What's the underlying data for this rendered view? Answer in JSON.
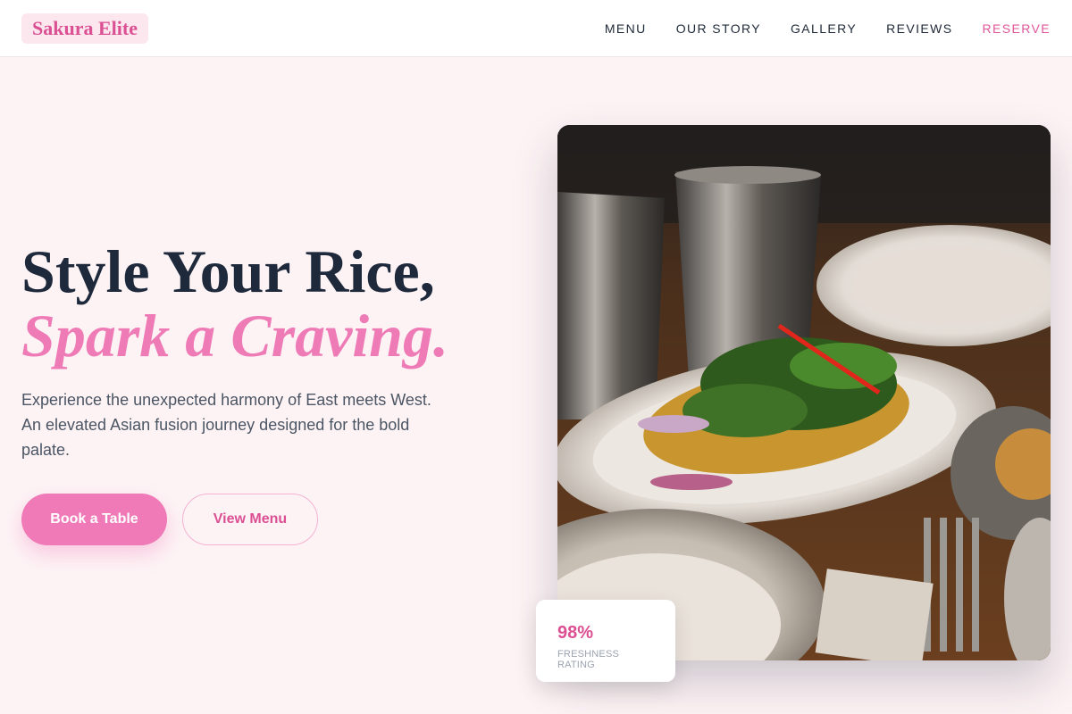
{
  "brand": {
    "name": "Sakura Elite"
  },
  "nav": {
    "items": [
      {
        "label": "MENU"
      },
      {
        "label": "OUR STORY"
      },
      {
        "label": "GALLERY"
      },
      {
        "label": "REVIEWS"
      },
      {
        "label": "RESERVE"
      }
    ]
  },
  "hero": {
    "title_line1": "Style Your Rice,",
    "title_line2": "Spark a Craving.",
    "tagline": "Experience the unexpected harmony of East meets West. An elevated Asian fusion journey designed for the bold palate.",
    "primary_button": "Book a Table",
    "secondary_button": "View Menu"
  },
  "badge": {
    "value": "98%",
    "label": "FRESHNESS RATING"
  },
  "colors": {
    "accent": "#f07ab8",
    "accent_text": "#db4f93",
    "background": "#fdf3f5",
    "heading": "#1e293b"
  }
}
